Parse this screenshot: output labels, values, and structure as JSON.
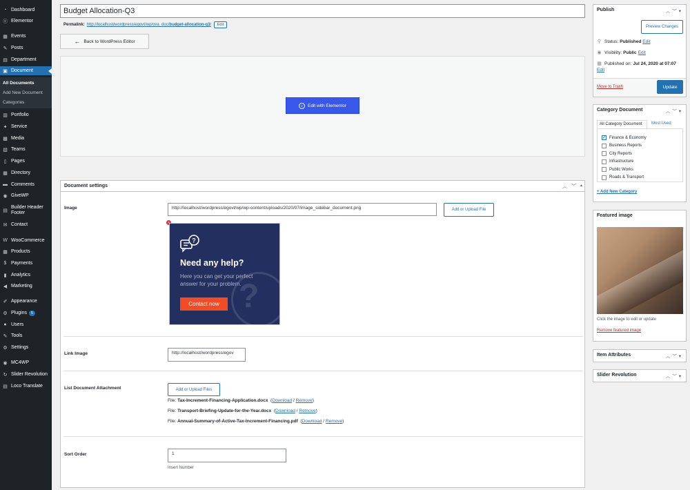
{
  "sidebar": {
    "items": [
      {
        "label": "Dashboard",
        "icon": "dashboard-icon",
        "glyph": "◔"
      },
      {
        "label": "Elementor",
        "icon": "elementor-icon",
        "glyph": "ⓔ"
      },
      {
        "label": "Events",
        "icon": "events-icon",
        "glyph": "▦"
      },
      {
        "label": "Posts",
        "icon": "posts-icon",
        "glyph": "✎"
      },
      {
        "label": "Department",
        "icon": "department-icon",
        "glyph": "▤"
      },
      {
        "label": "Document",
        "icon": "document-icon",
        "glyph": "▣"
      },
      {
        "label": "Portfolio",
        "icon": "portfolio-icon",
        "glyph": "▥"
      },
      {
        "label": "Service",
        "icon": "service-icon",
        "glyph": "✦"
      },
      {
        "label": "Media",
        "icon": "media-icon",
        "glyph": "▩"
      },
      {
        "label": "Teams",
        "icon": "teams-icon",
        "glyph": "▧"
      },
      {
        "label": "Pages",
        "icon": "pages-icon",
        "glyph": "▯"
      },
      {
        "label": "Directory",
        "icon": "directory-icon",
        "glyph": "▦"
      },
      {
        "label": "Comments",
        "icon": "comments-icon",
        "glyph": "▬"
      },
      {
        "label": "GiveWP",
        "icon": "givewp-icon",
        "glyph": "◉"
      },
      {
        "label": "Builder Header",
        "label2": "Footer",
        "icon": "builder-icon",
        "glyph": "▤"
      },
      {
        "label": "Contact",
        "icon": "contact-icon",
        "glyph": "✉"
      },
      {
        "label": "WooCommerce",
        "icon": "woocommerce-icon",
        "glyph": "W"
      },
      {
        "label": "Products",
        "icon": "products-icon",
        "glyph": "▦"
      },
      {
        "label": "Payments",
        "icon": "payments-icon",
        "glyph": "$"
      },
      {
        "label": "Analytics",
        "icon": "analytics-icon",
        "glyph": "▮"
      },
      {
        "label": "Marketing",
        "icon": "marketing-icon",
        "glyph": "◀"
      },
      {
        "label": "Appearance",
        "icon": "appearance-icon",
        "glyph": "✐"
      },
      {
        "label": "Plugins",
        "icon": "plugins-icon",
        "glyph": "⚙",
        "badge": "5"
      },
      {
        "label": "Users",
        "icon": "users-icon",
        "glyph": "●"
      },
      {
        "label": "Tools",
        "icon": "tools-icon",
        "glyph": "✎"
      },
      {
        "label": "Settings",
        "icon": "settings-icon",
        "glyph": "⚙"
      },
      {
        "label": "MC4WP",
        "icon": "mc4wp-icon",
        "glyph": "◉"
      },
      {
        "label": "Slider Revolution",
        "icon": "slider-revolution-icon",
        "glyph": "↻"
      },
      {
        "label": "Loco Translate",
        "icon": "loco-translate-icon",
        "glyph": "▤"
      }
    ],
    "submenu": [
      "All Documents",
      "Add New Document",
      "Categories"
    ]
  },
  "post": {
    "title": "Budget Allocation-Q3",
    "permalink_label": "Permalink:",
    "permalink_base": "http://localhost/wordpress/egovt/wp/ova_doc/",
    "permalink_slug": "budget-allocation-q3",
    "permalink_end": "/",
    "edit_label": "Edit"
  },
  "editor": {
    "back_label": "Back to WordPress Editor",
    "elementor_label": "Edit with Elementor"
  },
  "doc_settings": {
    "title": "Document settings",
    "image_label": "Image",
    "image_url": "http://localhost/wordpress/egovt/wp/wp-content/uploads/2020/07/image_sidebar_document.png",
    "upload_file_label": "Add or Upload File",
    "help_image": {
      "title": "Need any help?",
      "subtitle": "Here you can get your perfect answer for your problem.",
      "button": "Contact now"
    },
    "link_image_label": "Link Image",
    "link_image_value": "http://localhost/wordpress/egov",
    "attachment_label": "List Document Attachment",
    "upload_files_label": "Add or Upload Files",
    "files": [
      {
        "prefix": "File:",
        "name": "Tax-Increment-Financing-Application.docx",
        "download": "Download",
        "remove": "Remove"
      },
      {
        "prefix": "File:",
        "name": "Transport-Briefing-Update-for-the-Year.docx",
        "download": "Download",
        "remove": "Remove"
      },
      {
        "prefix": "File:",
        "name": "Annual-Summary-of-Active-Tax-Increment-Financing.pdf",
        "download": "Download",
        "remove": "Remove"
      }
    ],
    "sort_order_label": "Sort Order",
    "sort_order_value": "1",
    "sort_hint": "Insert Number"
  },
  "publish": {
    "title": "Publish",
    "preview_label": "Preview Changes",
    "status_label": "Status:",
    "status_value": "Published",
    "visibility_label": "Visibility:",
    "visibility_value": "Public",
    "published_label": "Published on:",
    "published_value": "Jul 24, 2020 at 07:07",
    "edit_label": "Edit",
    "trash_label": "Move to Trash",
    "update_label": "Update"
  },
  "category": {
    "title": "Category Document",
    "tab_all": "All Category Document",
    "tab_used": "Most Used",
    "items": [
      {
        "label": "Finance & Economy",
        "checked": true
      },
      {
        "label": "Business Reports",
        "checked": false
      },
      {
        "label": "City Reports",
        "checked": false
      },
      {
        "label": "Infrastructure",
        "checked": false
      },
      {
        "label": "Public Works",
        "checked": false
      },
      {
        "label": "Roads & Transport",
        "checked": false
      }
    ],
    "add_new": "+ Add New Category"
  },
  "featured": {
    "title": "Featured image",
    "hint": "Click the image to edit or update",
    "remove": "Remove featured image"
  },
  "item_attributes": {
    "title": "Item Attributes"
  },
  "slider_revolution": {
    "title": "Slider Revolution"
  },
  "colors": {
    "accent": "#2271b1",
    "elementor": "#3858e9",
    "sidebar": "#1d2327",
    "help_bg": "#23305f",
    "contact": "#f44b24"
  }
}
